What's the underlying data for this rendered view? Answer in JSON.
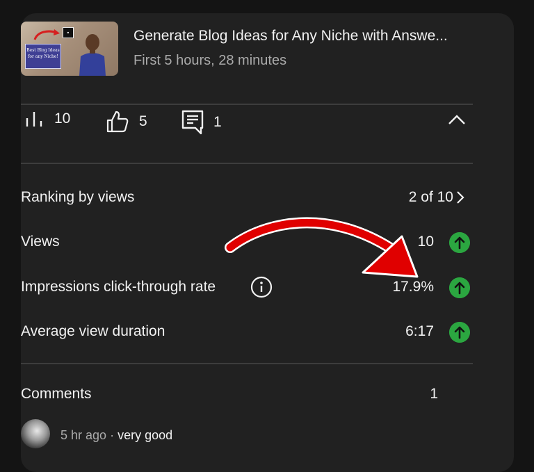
{
  "video": {
    "title": "Generate Blog Ideas for Any Niche with Answe...",
    "subtitle": "First 5 hours, 28 minutes",
    "thumbnail_text": "Best Blog Ideas for any Niche!"
  },
  "stats": {
    "views_count": "10",
    "likes_count": "5",
    "comments_count": "1"
  },
  "metrics": {
    "ranking_label": "Ranking by views",
    "ranking_value": "2 of 10",
    "views_label": "Views",
    "views_value": "10",
    "ctr_label": "Impressions click-through rate",
    "ctr_value": "17.9%",
    "avd_label": "Average view duration",
    "avd_value": "6:17"
  },
  "comments": {
    "label": "Comments",
    "count": "1",
    "latest": {
      "time": "5 hr ago",
      "separator": " · ",
      "text": "very good"
    }
  },
  "colors": {
    "background": "#141414",
    "card": "#212121",
    "trend_up": "#2ba640",
    "annotation_arrow": "#e00000"
  }
}
